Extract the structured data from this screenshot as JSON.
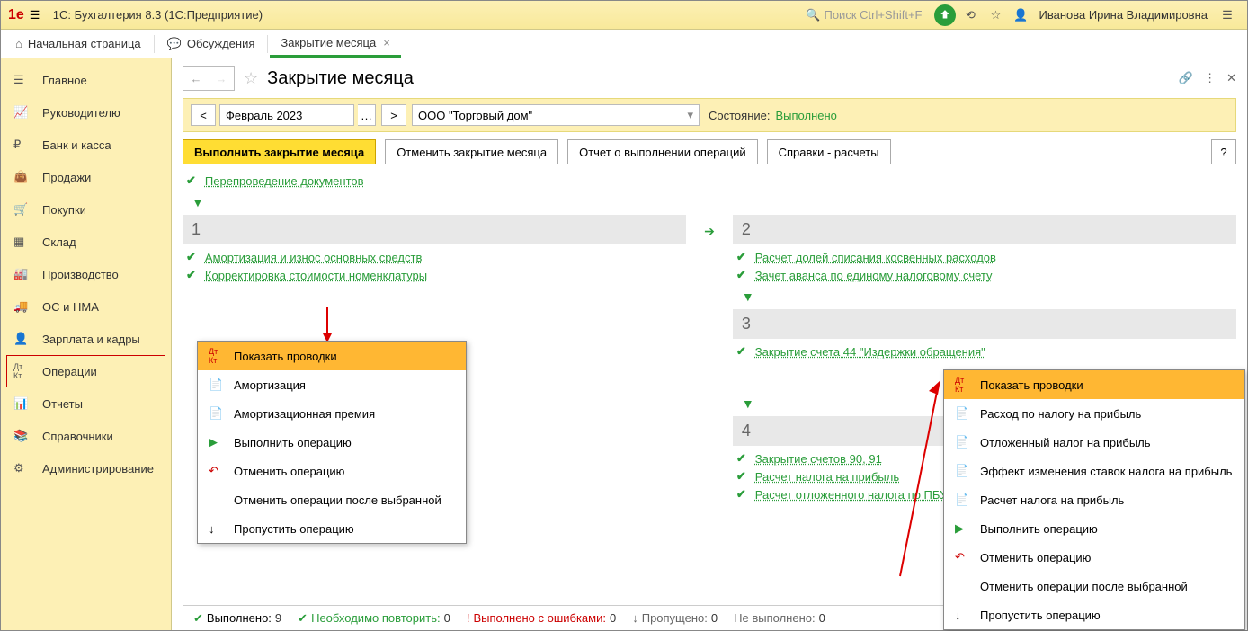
{
  "app_title": "1С: Бухгалтерия 8.3  (1С:Предприятие)",
  "header": {
    "search_placeholder": "Поиск Ctrl+Shift+F",
    "user": "Иванова Ирина Владимировна"
  },
  "tabs": [
    {
      "label": "Начальная страница",
      "closable": false,
      "active": false
    },
    {
      "label": "Обсуждения",
      "closable": false,
      "active": false
    },
    {
      "label": "Закрытие месяца",
      "closable": true,
      "active": true
    }
  ],
  "sidebar": {
    "items": [
      {
        "label": "Главное",
        "icon": "menu-icon"
      },
      {
        "label": "Руководителю",
        "icon": "chart-icon"
      },
      {
        "label": "Банк и касса",
        "icon": "ruble-icon"
      },
      {
        "label": "Продажи",
        "icon": "bag-icon"
      },
      {
        "label": "Покупки",
        "icon": "cart-icon"
      },
      {
        "label": "Склад",
        "icon": "boxes-icon"
      },
      {
        "label": "Производство",
        "icon": "factory-icon"
      },
      {
        "label": "ОС и НМА",
        "icon": "truck-icon"
      },
      {
        "label": "Зарплата и кадры",
        "icon": "person-icon"
      },
      {
        "label": "Операции",
        "icon": "dtkt-icon",
        "active": true
      },
      {
        "label": "Отчеты",
        "icon": "report-icon"
      },
      {
        "label": "Справочники",
        "icon": "book-icon"
      },
      {
        "label": "Администрирование",
        "icon": "gear-icon"
      }
    ]
  },
  "page": {
    "title": "Закрытие месяца",
    "period": "Февраль 2023",
    "organization": "ООО \"Торговый дом\"",
    "state_label": "Состояние:",
    "state_value": "Выполнено"
  },
  "buttons": {
    "run": "Выполнить закрытие месяца",
    "cancel": "Отменить закрытие месяца",
    "report": "Отчет о выполнении операций",
    "refs": "Справки - расчеты",
    "help": "?"
  },
  "ops_top": {
    "label": "Перепроведение документов"
  },
  "ops_left": {
    "step": "1",
    "items": [
      {
        "label": "Амортизация и износ основных средств"
      },
      {
        "label": "Корректировка стоимости номенклатуры"
      }
    ]
  },
  "ops_right": [
    {
      "step": "2",
      "items": [
        {
          "label": "Расчет долей списания косвенных расходов"
        },
        {
          "label": "Зачет аванса по единому налоговому счету"
        }
      ]
    },
    {
      "step": "3",
      "items": [
        {
          "label": "Закрытие счета 44 \"Издержки обращения\""
        }
      ]
    },
    {
      "step": "4",
      "items": [
        {
          "label": "Закрытие счетов 90, 91"
        },
        {
          "label": "Расчет налога на прибыль"
        },
        {
          "label": "Расчет отложенного налога по ПБУ 18"
        }
      ]
    }
  ],
  "ctx_menu1": [
    {
      "label": "Показать проводки",
      "icon": "dtkt-icon",
      "hl": true
    },
    {
      "label": "Амортизация",
      "icon": "doc-icon"
    },
    {
      "label": "Амортизационная премия",
      "icon": "doc-icon"
    },
    {
      "label": "Выполнить операцию",
      "icon": "run-icon"
    },
    {
      "label": "Отменить операцию",
      "icon": "undo-icon"
    },
    {
      "label": "Отменить операции после выбранной",
      "icon": ""
    },
    {
      "label": "Пропустить операцию",
      "icon": "skip-icon"
    }
  ],
  "ctx_menu2": [
    {
      "label": "Показать проводки",
      "icon": "dtkt-icon",
      "hl": true
    },
    {
      "label": "Расход по налогу на прибыль",
      "icon": "doc-icon"
    },
    {
      "label": "Отложенный налог на прибыль",
      "icon": "doc-icon"
    },
    {
      "label": "Эффект изменения ставок налога на прибыль",
      "icon": "doc-icon"
    },
    {
      "label": "Расчет налога на прибыль",
      "icon": "doc-icon"
    },
    {
      "label": "Выполнить операцию",
      "icon": "run-icon"
    },
    {
      "label": "Отменить операцию",
      "icon": "undo-icon"
    },
    {
      "label": "Отменить операции после выбранной",
      "icon": ""
    },
    {
      "label": "Пропустить операцию",
      "icon": "skip-icon"
    }
  ],
  "status": {
    "done_label": "Выполнено:",
    "done": "9",
    "repeat_label": "Необходимо повторить:",
    "repeat": "0",
    "errors_label": "Выполнено с ошибками:",
    "errors": "0",
    "skipped_label": "Пропущено:",
    "skipped": "0",
    "notdone_label": "Не выполнено:",
    "notdone": "0"
  }
}
